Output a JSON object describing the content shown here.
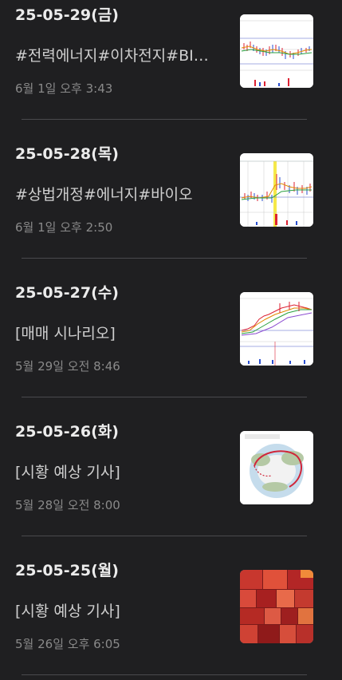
{
  "posts": [
    {
      "title": "25-05-29(금)",
      "summary": "#전력에너지#이차전지#BI…",
      "date": "6월 1일 오후 3:43",
      "thumbnail": "stock-chart-thumbnail"
    },
    {
      "title": "25-05-28(목)",
      "summary": "#상법개정#에너지#바이오",
      "date": "6월 1일 오후 2:50",
      "thumbnail": "stock-chart-thumbnail"
    },
    {
      "title": "25-05-27(수)",
      "summary": "[매매 시나리오]",
      "date": "5월 29일 오전 8:46",
      "thumbnail": "stock-chart-thumbnail"
    },
    {
      "title": "25-05-26(화)",
      "summary": "[시황 예상 기사]",
      "date": "5월 28일 오전 8:00",
      "thumbnail": "map-thumbnail"
    },
    {
      "title": "25-05-25(월)",
      "summary": "[시황 예상 기사]",
      "date": "5월 26일 오후 6:05",
      "thumbnail": "heatmap-thumbnail"
    }
  ],
  "colors": {
    "background": "#1f1f21",
    "title": "#ececec",
    "summary": "#cfcfcf",
    "date": "#8a8a8a",
    "divider": "#4a4a4d"
  }
}
